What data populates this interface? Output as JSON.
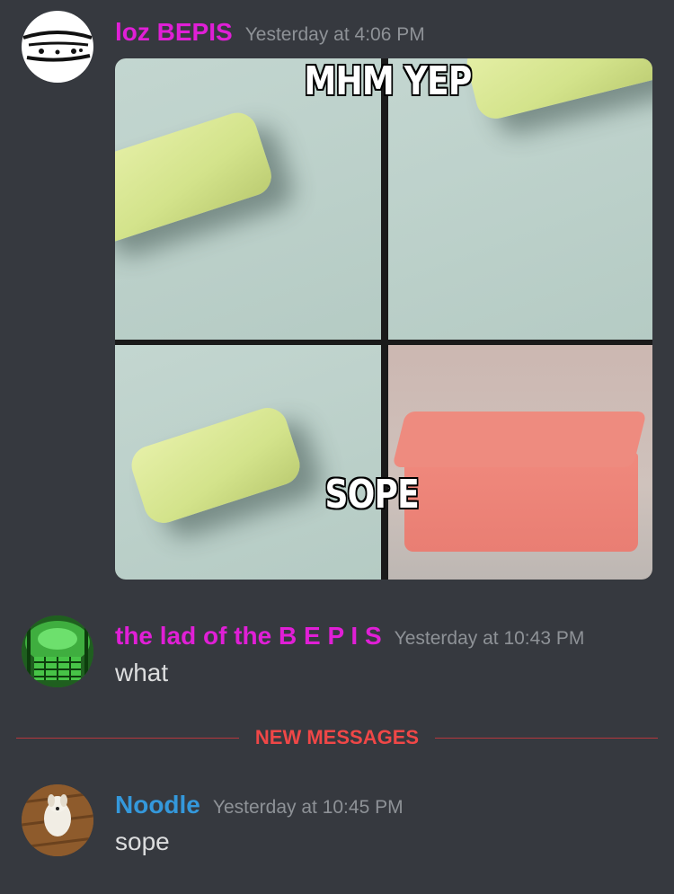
{
  "messages": [
    {
      "username": "loz BEPIS",
      "username_color": "#e01fd6",
      "timestamp": "Yesterday at 4:06 PM",
      "attachment": {
        "top_text": "MHM YEP",
        "bottom_text": "SOPE"
      }
    },
    {
      "username": "the lad of the B E P I S",
      "username_color": "#e01fd6",
      "timestamp": "Yesterday at 10:43 PM",
      "content": "what"
    },
    {
      "username": "Noodle",
      "username_color": "#3498db",
      "timestamp": "Yesterday at 10:45 PM",
      "content": "sope"
    }
  ],
  "divider": {
    "label": "NEW MESSAGES"
  }
}
